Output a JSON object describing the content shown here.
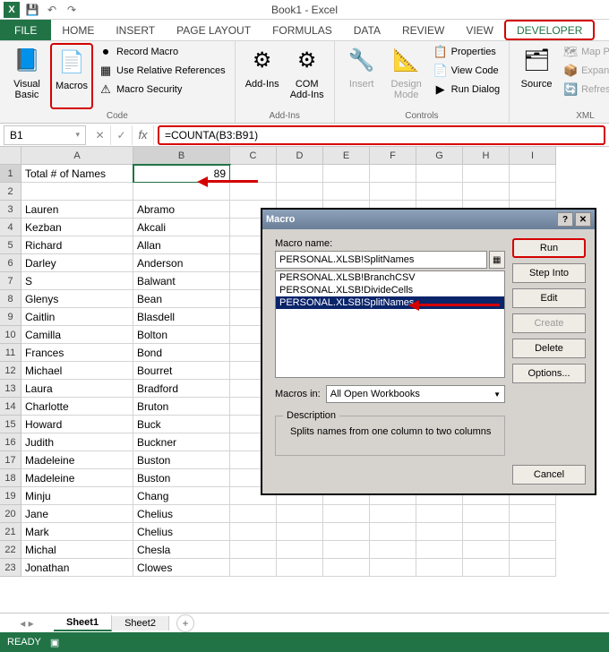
{
  "app": {
    "title": "Book1 - Excel"
  },
  "tabs": [
    "FILE",
    "HOME",
    "INSERT",
    "PAGE LAYOUT",
    "FORMULAS",
    "DATA",
    "REVIEW",
    "VIEW",
    "DEVELOPER"
  ],
  "ribbon": {
    "visual_basic": "Visual\nBasic",
    "macros": "Macros",
    "record_macro": "Record Macro",
    "use_relative": "Use Relative References",
    "macro_security": "Macro Security",
    "group_code": "Code",
    "addins": "Add-Ins",
    "com_addins": "COM\nAdd-Ins",
    "group_addins": "Add-Ins",
    "insert": "Insert",
    "design_mode": "Design\nMode",
    "properties": "Properties",
    "view_code": "View Code",
    "run_dialog": "Run Dialog",
    "group_controls": "Controls",
    "source": "Source",
    "map_props": "Map Properties",
    "expansion": "Expansion Pack",
    "refresh_data": "Refresh Data",
    "group_xml": "XML"
  },
  "formula_bar": {
    "name_box": "B1",
    "formula": "=COUNTA(B3:B91)"
  },
  "columns": [
    "A",
    "B",
    "C",
    "D",
    "E",
    "F",
    "G",
    "H",
    "I"
  ],
  "rows": [
    {
      "n": 1,
      "a": "Total # of Names",
      "b": "89"
    },
    {
      "n": 2,
      "a": "",
      "b": ""
    },
    {
      "n": 3,
      "a": "Lauren",
      "b": "Abramo"
    },
    {
      "n": 4,
      "a": "Kezban",
      "b": "Akcali"
    },
    {
      "n": 5,
      "a": "Richard",
      "b": "Allan"
    },
    {
      "n": 6,
      "a": "Darley",
      "b": "Anderson"
    },
    {
      "n": 7,
      "a": "S",
      "b": "Balwant"
    },
    {
      "n": 8,
      "a": "Glenys",
      "b": "Bean"
    },
    {
      "n": 9,
      "a": "Caitlin",
      "b": "Blasdell"
    },
    {
      "n": 10,
      "a": "Camilla",
      "b": "Bolton"
    },
    {
      "n": 11,
      "a": "Frances",
      "b": "Bond"
    },
    {
      "n": 12,
      "a": "Michael",
      "b": "Bourret"
    },
    {
      "n": 13,
      "a": "Laura",
      "b": "Bradford"
    },
    {
      "n": 14,
      "a": "Charlotte",
      "b": "Bruton"
    },
    {
      "n": 15,
      "a": "Howard",
      "b": "Buck"
    },
    {
      "n": 16,
      "a": "Judith",
      "b": "Buckner"
    },
    {
      "n": 17,
      "a": "Madeleine",
      "b": "Buston"
    },
    {
      "n": 18,
      "a": "Madeleine",
      "b": "Buston"
    },
    {
      "n": 19,
      "a": "Minju",
      "b": "Chang"
    },
    {
      "n": 20,
      "a": "Jane",
      "b": "Chelius"
    },
    {
      "n": 21,
      "a": "Mark",
      "b": "Chelius"
    },
    {
      "n": 22,
      "a": "Michal",
      "b": "Chesla"
    },
    {
      "n": 23,
      "a": "Jonathan",
      "b": "Clowes"
    }
  ],
  "sheets": {
    "active": "Sheet1",
    "other": "Sheet2"
  },
  "status": "READY",
  "dialog": {
    "title": "Macro",
    "macro_name_label": "Macro name:",
    "macro_name": "PERSONAL.XLSB!SplitNames",
    "items": [
      "PERSONAL.XLSB!BranchCSV",
      "PERSONAL.XLSB!DivideCells",
      "PERSONAL.XLSB!SplitNames"
    ],
    "macros_in_label": "Macros in:",
    "macros_in": "All Open Workbooks",
    "desc_label": "Description",
    "desc": "Splits names from one column to two columns",
    "run": "Run",
    "step_into": "Step Into",
    "edit": "Edit",
    "create": "Create",
    "delete": "Delete",
    "options": "Options...",
    "cancel": "Cancel"
  }
}
